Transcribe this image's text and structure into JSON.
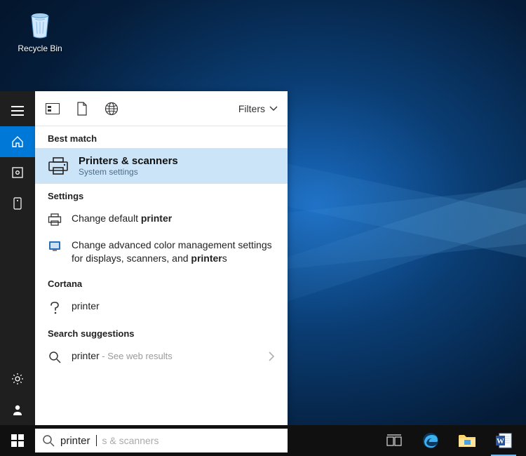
{
  "desktop": {
    "recycle_bin_label": "Recycle Bin"
  },
  "toprow": {
    "filters_label": "Filters"
  },
  "sections": {
    "best_match": "Best match",
    "settings": "Settings",
    "cortana": "Cortana",
    "search_suggestions": "Search suggestions"
  },
  "best_match_item": {
    "title_prefix_bold": "Printer",
    "title_rest": "s & scanners",
    "subtitle": "System settings"
  },
  "settings_items": {
    "change_default_pre": "Change default ",
    "change_default_bold": "printer",
    "adv_color_pre": "Change advanced color management settings for displays, scanners, and ",
    "adv_color_bold": "printer",
    "adv_color_post": "s"
  },
  "cortana_item": {
    "text": "printer"
  },
  "suggestion_item": {
    "text": "printer",
    "hint": " - See web results"
  },
  "searchbox": {
    "typed": "printer",
    "placeholder_remainder": "s & scanners"
  }
}
